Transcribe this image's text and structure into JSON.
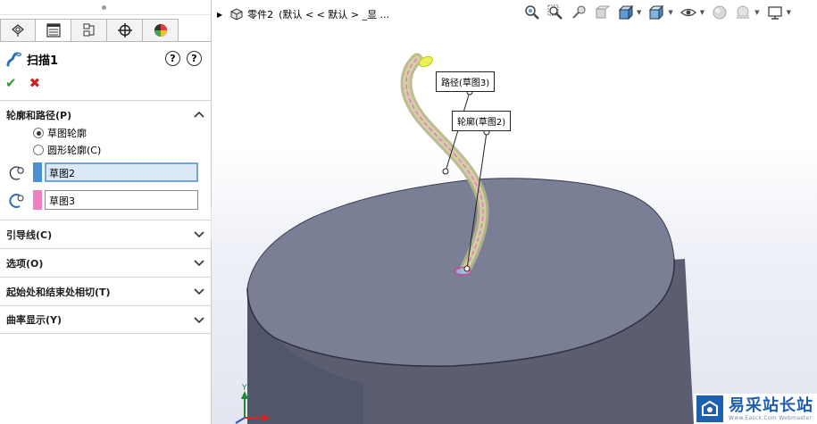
{
  "feature": {
    "title": "扫描1"
  },
  "tree": {
    "part_label": "零件2",
    "config_label": "(默认 < < 默认 > _显 ..."
  },
  "tabs": [
    "feature-manager",
    "property-manager",
    "configuration-manager",
    "dim-xpert-manager",
    "display-manager"
  ],
  "sections": {
    "profile_path": {
      "header": "轮廓和路径(P)",
      "radio_options": [
        {
          "label": "草图轮廓",
          "selected": true
        },
        {
          "label": "圆形轮廓(C)",
          "selected": false
        }
      ],
      "profile_field": {
        "value": "草图2",
        "swatch": "#4a90d9"
      },
      "path_field": {
        "value": "草图3",
        "swatch": "#f080c0"
      }
    },
    "guide": {
      "header": "引导线(C)"
    },
    "options": {
      "header": "选项(O)"
    },
    "tangency": {
      "header": "起始处和结束处相切(T)"
    },
    "curvature": {
      "header": "曲率显示(Y)"
    }
  },
  "callouts": {
    "path": "路径(草图3)",
    "profile": "轮廓(草图2)"
  },
  "triad": {
    "y_label": "Y"
  },
  "watermark": {
    "main": "易采站长站",
    "sub": "Www.Easck.Com Webmaster"
  },
  "colors": {
    "cylinder_top": "#7b7f96",
    "cylinder_side": "#5a5e70",
    "sweep": "#c8c79a"
  }
}
